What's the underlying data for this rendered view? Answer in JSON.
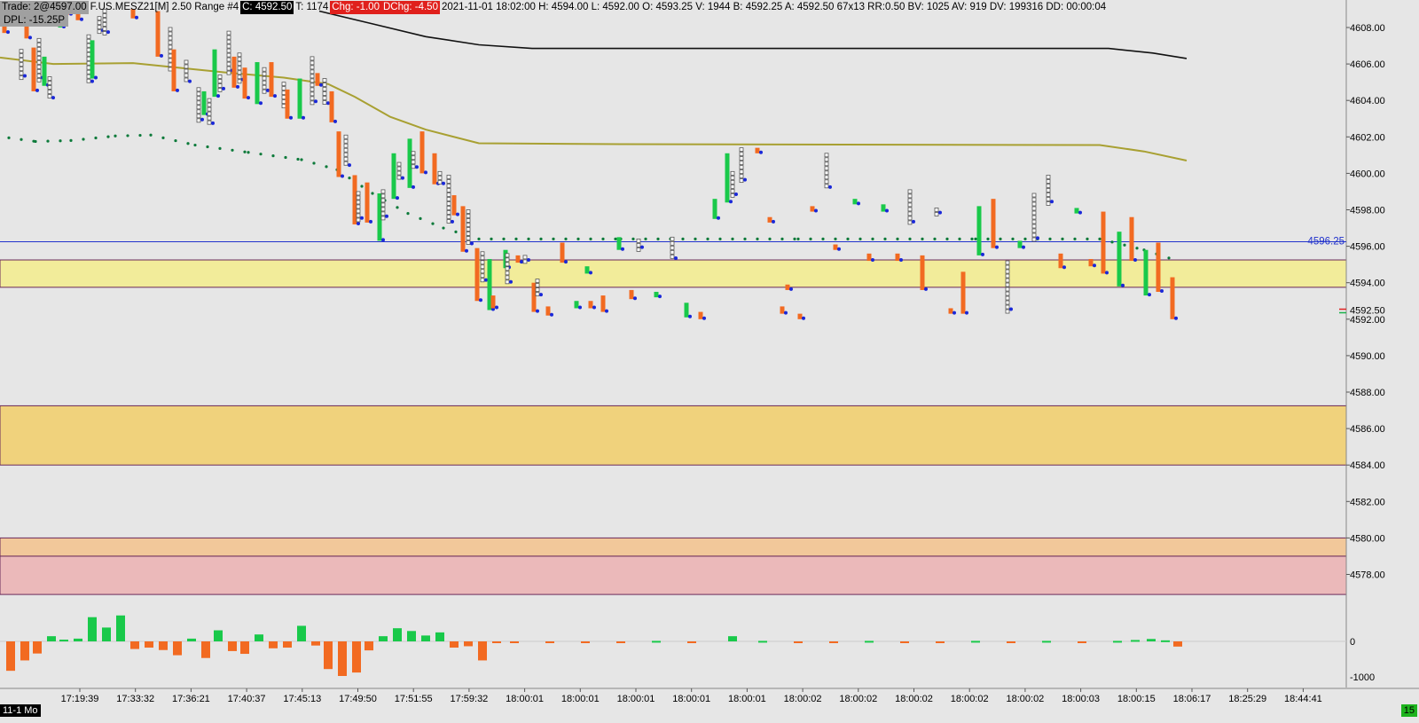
{
  "header": {
    "trade": "Trade: 2@4597.00",
    "symbol": "F.US.MESZ21[M]  2.50 Range  #4",
    "close": "C: 4592.50",
    "ticks": "T: 1174",
    "chg": "Chg: -1.00",
    "dchg": "DChg: -4.50",
    "stats": "2021-11-01 18:02:00 H: 4594.00 L: 4592.00 O: 4593.25 V: 1944 B: 4592.25 A: 4592.50 67x13 RR:0.50 BV: 1025 AV: 919 DV: 199316 DD: 00:00:04"
  },
  "dpl": "DPL: -15.25P",
  "date_badge": "11-1 Mo",
  "bar_count": "15",
  "price_line_label": "4596.25",
  "current_price_label": "4592.50",
  "colors": {
    "background": "#e6e6e6",
    "up": "#19c94a",
    "down": "#f26a21",
    "vwap": "#a8a032",
    "slow_ma": "#111111",
    "dots": "#0c7a3a",
    "price_line": "#2233cc",
    "zone_yellow": "#f2ec9a",
    "zone_orange": "#f0d27c",
    "zone_peach": "#f2c89a",
    "zone_pink": "#ebb9ba"
  },
  "chart_data": [
    {
      "type": "line",
      "ylim": [
        4576.0,
        4609.0
      ],
      "price_ticks": [
        "4608.00",
        "4606.00",
        "4604.00",
        "4602.00",
        "4600.00",
        "4598.00",
        "4596.00",
        "4594.00",
        "4592.00",
        "4590.00",
        "4588.00",
        "4586.00",
        "4584.00",
        "4582.00",
        "4580.00",
        "4578.00"
      ],
      "time_labels": [
        "17:19:39",
        "17:33:32",
        "17:36:21",
        "17:40:37",
        "17:45:13",
        "17:49:50",
        "17:51:55",
        "17:59:32",
        "18:00:01",
        "18:00:01",
        "18:00:01",
        "18:00:01",
        "18:00:01",
        "18:00:02",
        "18:00:02",
        "18:00:02",
        "18:00:02",
        "18:00:02",
        "18:00:03",
        "18:00:15",
        "18:06:17",
        "18:25:29",
        "18:44:41"
      ],
      "price_line": 4596.25,
      "zones": [
        {
          "name": "zone-yellow",
          "from": 4593.75,
          "to": 4595.25,
          "color": "#f2ec9a"
        },
        {
          "name": "zone-orange",
          "from": 4584.0,
          "to": 4587.25,
          "color": "#f0d27c"
        },
        {
          "name": "zone-peach",
          "from": 4579.0,
          "to": 4580.0,
          "color": "#f2c89a"
        },
        {
          "name": "zone-pink",
          "from": 4576.9,
          "to": 4579.0,
          "color": "#ebb9ba"
        }
      ],
      "series": [
        {
          "key": "slow_ma",
          "color": "#111111",
          "points": [
            [
              360,
              4608.9
            ],
            [
              420,
              4608.2
            ],
            [
              480,
              4607.5
            ],
            [
              540,
              4607.05
            ],
            [
              600,
              4606.85
            ],
            [
              900,
              4606.85
            ],
            [
              1250,
              4606.85
            ],
            [
              1300,
              4606.6
            ],
            [
              1338,
              4606.3
            ]
          ]
        },
        {
          "key": "vwap",
          "color": "#a8a032",
          "points": [
            [
              0,
              4606.35
            ],
            [
              60,
              4606.0
            ],
            [
              150,
              4606.05
            ],
            [
              250,
              4605.55
            ],
            [
              320,
              4605.25
            ],
            [
              370,
              4604.9
            ],
            [
              400,
              4604.2
            ],
            [
              440,
              4603.1
            ],
            [
              480,
              4602.4
            ],
            [
              540,
              4601.65
            ],
            [
              700,
              4601.6
            ],
            [
              1240,
              4601.55
            ],
            [
              1290,
              4601.2
            ],
            [
              1338,
              4600.7
            ]
          ]
        },
        {
          "key": "dots",
          "color": "#0c7a3a",
          "points": [
            [
              10,
              4601.95
            ],
            [
              40,
              4601.75
            ],
            [
              80,
              4601.8
            ],
            [
              130,
              4602.05
            ],
            [
              170,
              4602.1
            ],
            [
              220,
              4601.55
            ],
            [
              280,
              4601.15
            ],
            [
              340,
              4600.75
            ],
            [
              380,
              4600.2
            ],
            [
              420,
              4598.9
            ],
            [
              460,
              4597.8
            ],
            [
              500,
              4597.0
            ],
            [
              540,
              4596.4
            ],
            [
              700,
              4596.4
            ],
            [
              900,
              4596.4
            ],
            [
              1100,
              4596.4
            ],
            [
              1240,
              4596.4
            ],
            [
              1290,
              4595.8
            ],
            [
              1328,
              4595.2
            ]
          ]
        }
      ],
      "bars": [
        [
          5,
          4608.6,
          4607.7,
          "down"
        ],
        [
          18,
          4609,
          4608.2,
          "up"
        ],
        [
          24,
          4606.8,
          4605.3,
          "none"
        ],
        [
          30,
          4608.4,
          4607.4,
          "down"
        ],
        [
          38,
          4606.9,
          4604.5,
          "down"
        ],
        [
          44,
          4607.4,
          4605.2,
          "none"
        ],
        [
          50,
          4606.4,
          4604.8,
          "up"
        ],
        [
          56,
          4605.3,
          4604.1,
          "none"
        ],
        [
          68,
          4609,
          4608.0,
          "up"
        ],
        [
          76,
          4609,
          4608.7,
          "down"
        ],
        [
          88,
          4609,
          4608.4,
          "down"
        ],
        [
          100,
          4607.6,
          4605.0,
          "none"
        ],
        [
          104,
          4607.3,
          4605.2,
          "up"
        ],
        [
          112,
          4608.6,
          4607.8,
          "none"
        ],
        [
          118,
          4609,
          4607.7,
          "none"
        ],
        [
          150,
          4609,
          4608.5,
          "down"
        ],
        [
          178,
          4608.9,
          4606.4,
          "down"
        ],
        [
          192,
          4608.0,
          4605.7,
          "none"
        ],
        [
          196,
          4606.8,
          4604.5,
          "down"
        ],
        [
          210,
          4606.2,
          4605.0,
          "none"
        ],
        [
          224,
          4604.7,
          4602.9,
          "none"
        ],
        [
          230,
          4604.5,
          4603.2,
          "up"
        ],
        [
          236,
          4604.1,
          4602.7,
          "none"
        ],
        [
          242,
          4606.8,
          4604.2,
          "up"
        ],
        [
          248,
          4605.4,
          4604.6,
          "none"
        ],
        [
          258,
          4607.8,
          4605.6,
          "none"
        ],
        [
          264,
          4606.4,
          4604.7,
          "down"
        ],
        [
          270,
          4606.6,
          4605.1,
          "none"
        ],
        [
          276,
          4605.8,
          4604.1,
          "down"
        ],
        [
          290,
          4606.1,
          4603.8,
          "up"
        ],
        [
          298,
          4605.8,
          4604.5,
          "none"
        ],
        [
          306,
          4606.1,
          4604.2,
          "down"
        ],
        [
          320,
          4605.0,
          4603.7,
          "none"
        ],
        [
          324,
          4604.6,
          4603.0,
          "down"
        ],
        [
          338,
          4605.2,
          4603.0,
          "up"
        ],
        [
          352,
          4606.4,
          4603.9,
          "none"
        ],
        [
          358,
          4605.5,
          4604.8,
          "down"
        ],
        [
          366,
          4605.2,
          4603.8,
          "none"
        ],
        [
          374,
          4604.5,
          4602.8,
          "down"
        ],
        [
          382,
          4602.3,
          4599.8,
          "down"
        ],
        [
          390,
          4602.1,
          4600.4,
          "none"
        ],
        [
          400,
          4599.9,
          4597.2,
          "down"
        ],
        [
          404,
          4599.0,
          4597.5,
          "none"
        ],
        [
          414,
          4599.5,
          4597.3,
          "down"
        ],
        [
          428,
          4598.9,
          4596.3,
          "up"
        ],
        [
          432,
          4599.1,
          4597.6,
          "none"
        ],
        [
          444,
          4601.1,
          4598.6,
          "up"
        ],
        [
          450,
          4600.6,
          4599.7,
          "none"
        ],
        [
          462,
          4601.9,
          4599.2,
          "up"
        ],
        [
          466,
          4601.2,
          4600.3,
          "none"
        ],
        [
          476,
          4602.3,
          4600.0,
          "down"
        ],
        [
          490,
          4601.1,
          4599.4,
          "down"
        ],
        [
          496,
          4600.1,
          4599.4,
          "none"
        ],
        [
          506,
          4599.9,
          4597.3,
          "none"
        ],
        [
          512,
          4598.8,
          4597.7,
          "down"
        ],
        [
          522,
          4598.2,
          4595.7,
          "down"
        ],
        [
          528,
          4598.0,
          4596.1,
          "none"
        ],
        [
          538,
          4595.9,
          4593.0,
          "down"
        ],
        [
          544,
          4595.7,
          4594.1,
          "none"
        ],
        [
          552,
          4595.3,
          4592.5,
          "up"
        ],
        [
          556,
          4593.3,
          4592.6,
          "down"
        ],
        [
          570,
          4595.8,
          4594.8,
          "up"
        ],
        [
          572,
          4595.6,
          4594.0,
          "none"
        ],
        [
          584,
          4595.5,
          4595.1,
          "down"
        ],
        [
          592,
          4595.5,
          4595.2,
          "none"
        ],
        [
          602,
          4594.0,
          4592.4,
          "down"
        ],
        [
          606,
          4594.2,
          4593.3,
          "none"
        ],
        [
          618,
          4592.7,
          4592.2,
          "down"
        ],
        [
          634,
          4596.2,
          4595.1,
          "down"
        ],
        [
          650,
          4593.0,
          4592.6,
          "up"
        ],
        [
          662,
          4594.9,
          4594.5,
          "up"
        ],
        [
          666,
          4593.0,
          4592.6,
          "down"
        ],
        [
          680,
          4593.3,
          4592.4,
          "down"
        ],
        [
          698,
          4596.5,
          4595.8,
          "up"
        ],
        [
          712,
          4593.6,
          4593.1,
          "down"
        ],
        [
          720,
          4596.4,
          4595.9,
          "none"
        ],
        [
          740,
          4593.5,
          4593.2,
          "up"
        ],
        [
          758,
          4596.5,
          4595.3,
          "none"
        ],
        [
          774,
          4592.9,
          4592.1,
          "up"
        ],
        [
          790,
          4592.4,
          4592.0,
          "down"
        ],
        [
          806,
          4598.6,
          4597.5,
          "up"
        ],
        [
          820,
          4601.1,
          4598.4,
          "up"
        ],
        [
          826,
          4600.1,
          4598.8,
          "none"
        ],
        [
          836,
          4601.4,
          4599.6,
          "none"
        ],
        [
          854,
          4601.4,
          4601.1,
          "down"
        ],
        [
          868,
          4597.6,
          4597.3,
          "down"
        ],
        [
          882,
          4592.7,
          4592.3,
          "down"
        ],
        [
          888,
          4593.9,
          4593.6,
          "down"
        ],
        [
          902,
          4592.3,
          4592.0,
          "down"
        ],
        [
          916,
          4598.2,
          4597.9,
          "down"
        ],
        [
          932,
          4601.1,
          4599.2,
          "none"
        ],
        [
          942,
          4596.1,
          4595.8,
          "down"
        ],
        [
          964,
          4598.6,
          4598.3,
          "up"
        ],
        [
          980,
          4595.6,
          4595.2,
          "down"
        ],
        [
          996,
          4598.3,
          4597.9,
          "up"
        ],
        [
          1012,
          4595.6,
          4595.2,
          "down"
        ],
        [
          1026,
          4599.1,
          4597.3,
          "none"
        ],
        [
          1040,
          4595.5,
          4593.6,
          "down"
        ],
        [
          1056,
          4598.1,
          4597.8,
          "none"
        ],
        [
          1072,
          4592.6,
          4592.3,
          "down"
        ],
        [
          1086,
          4594.6,
          4592.3,
          "down"
        ],
        [
          1104,
          4598.2,
          4595.5,
          "up"
        ],
        [
          1120,
          4598.6,
          4595.9,
          "down"
        ],
        [
          1136,
          4595.2,
          4592.5,
          "none"
        ],
        [
          1150,
          4596.3,
          4595.9,
          "up"
        ],
        [
          1166,
          4598.9,
          4596.4,
          "none"
        ],
        [
          1182,
          4599.9,
          4598.4,
          "none"
        ],
        [
          1196,
          4595.6,
          4594.8,
          "down"
        ],
        [
          1214,
          4598.1,
          4597.8,
          "up"
        ],
        [
          1230,
          4595.3,
          4594.9,
          "down"
        ],
        [
          1244,
          4597.9,
          4594.5,
          "down"
        ],
        [
          1262,
          4596.8,
          4593.8,
          "up"
        ],
        [
          1276,
          4597.6,
          4595.2,
          "down"
        ],
        [
          1292,
          4595.8,
          4593.3,
          "up"
        ],
        [
          1306,
          4596.2,
          4593.5,
          "down"
        ],
        [
          1322,
          4594.3,
          4592.0,
          "down"
        ]
      ]
    },
    {
      "type": "bar",
      "ylabel_ticks": [
        "0",
        "-1000"
      ],
      "ylim": [
        -1100,
        800
      ],
      "values": [
        [
          12,
          -850
        ],
        [
          28,
          -550
        ],
        [
          42,
          -350
        ],
        [
          58,
          150
        ],
        [
          72,
          50
        ],
        [
          88,
          80
        ],
        [
          104,
          700
        ],
        [
          120,
          400
        ],
        [
          136,
          750
        ],
        [
          152,
          -220
        ],
        [
          168,
          -180
        ],
        [
          184,
          -250
        ],
        [
          200,
          -400
        ],
        [
          216,
          80
        ],
        [
          232,
          -480
        ],
        [
          246,
          320
        ],
        [
          262,
          -280
        ],
        [
          276,
          -360
        ],
        [
          292,
          200
        ],
        [
          308,
          -200
        ],
        [
          324,
          -180
        ],
        [
          340,
          450
        ],
        [
          356,
          -120
        ],
        [
          370,
          -800
        ],
        [
          386,
          -1000
        ],
        [
          402,
          -900
        ],
        [
          416,
          -260
        ],
        [
          432,
          150
        ],
        [
          448,
          380
        ],
        [
          464,
          300
        ],
        [
          480,
          170
        ],
        [
          496,
          260
        ],
        [
          512,
          -180
        ],
        [
          528,
          -140
        ],
        [
          544,
          -550
        ],
        [
          560,
          -30
        ],
        [
          580,
          -15
        ],
        [
          620,
          -15
        ],
        [
          660,
          -15
        ],
        [
          700,
          -15
        ],
        [
          740,
          15
        ],
        [
          780,
          -15
        ],
        [
          826,
          150
        ],
        [
          860,
          15
        ],
        [
          900,
          -15
        ],
        [
          940,
          -15
        ],
        [
          980,
          15
        ],
        [
          1020,
          -15
        ],
        [
          1060,
          -15
        ],
        [
          1100,
          15
        ],
        [
          1140,
          -15
        ],
        [
          1180,
          15
        ],
        [
          1220,
          -15
        ],
        [
          1260,
          15
        ],
        [
          1280,
          40
        ],
        [
          1298,
          70
        ],
        [
          1314,
          30
        ],
        [
          1328,
          -150
        ]
      ]
    }
  ]
}
